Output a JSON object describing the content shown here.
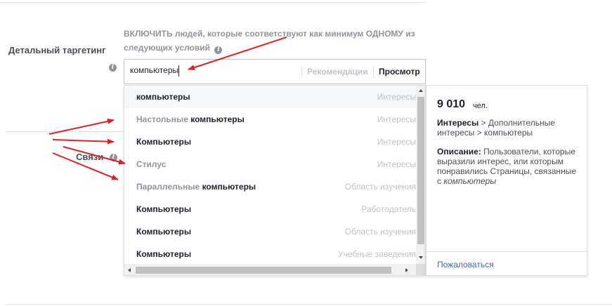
{
  "section": {
    "label": "Детальный таргетинг",
    "description": "ВКЛЮЧИТЬ людей, которые соответствуют как минимум ОДНОМУ из следующих условий"
  },
  "connections": {
    "label": "Связи"
  },
  "search": {
    "value": "компьютеры",
    "recommendations_label": "Рекомендации",
    "browse_label": "Просмотр"
  },
  "suggestions": [
    {
      "prefix": "",
      "term": "компьютеры",
      "type": "Интересы"
    },
    {
      "prefix": "Настольные ",
      "term": "компьютеры",
      "type": "Интересы"
    },
    {
      "prefix": "",
      "term": "Компьютеры",
      "type": "Интересы"
    },
    {
      "prefix": "Стилус",
      "term": "",
      "type": "Интересы"
    },
    {
      "prefix": "Параллельные ",
      "term": "компьютеры",
      "type": "Область изучения"
    },
    {
      "prefix": "",
      "term": "Компьютеры",
      "type": "Работодатель"
    },
    {
      "prefix": "",
      "term": "Компьютеры",
      "type": "Область изучения"
    },
    {
      "prefix": "",
      "term": "Компьютеры",
      "type": "Учебные заведения"
    }
  ],
  "details": {
    "audience_size": "9 010",
    "audience_unit": "чел.",
    "path_category": "Интересы",
    "path_rest": " > Дополнительные интересы > компьютеры",
    "description_label": "Описание:",
    "description_text": " Пользователи, которые выразили интерес, или которым понравились Страницы, связанные с ",
    "description_term": "компьютеры",
    "report_label": "Пожаловаться"
  },
  "colors": {
    "link": "#4267b2",
    "annotation_arrows": "#e02020",
    "border": "#dddfe2"
  }
}
